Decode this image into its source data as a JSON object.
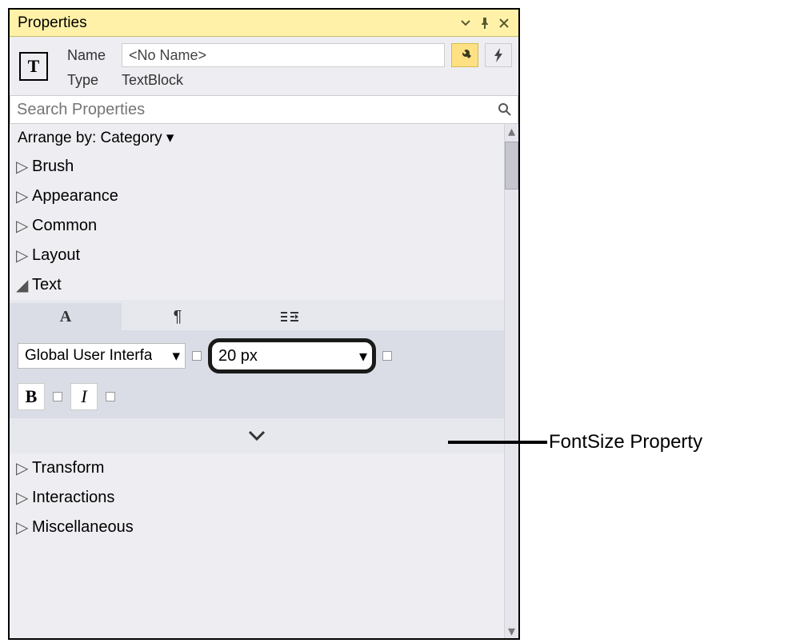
{
  "titlebar": {
    "title": "Properties"
  },
  "header": {
    "name_label": "Name",
    "name_value": "<No Name>",
    "type_label": "Type",
    "type_value": "TextBlock",
    "type_glyph": "T"
  },
  "search": {
    "placeholder": "Search Properties"
  },
  "arrange": {
    "label": "Arrange by: Category"
  },
  "categories": {
    "brush": "Brush",
    "appearance": "Appearance",
    "common": "Common",
    "layout": "Layout",
    "text": "Text",
    "transform": "Transform",
    "interactions": "Interactions",
    "misc": "Miscellaneous"
  },
  "text_section": {
    "tab_font_glyph": "A",
    "tab_paragraph_glyph": "¶",
    "font_family": "Global User Interfa",
    "font_size": "20 px",
    "bold_glyph": "B",
    "italic_glyph": "I"
  },
  "callout": {
    "label": "FontSize Property"
  }
}
